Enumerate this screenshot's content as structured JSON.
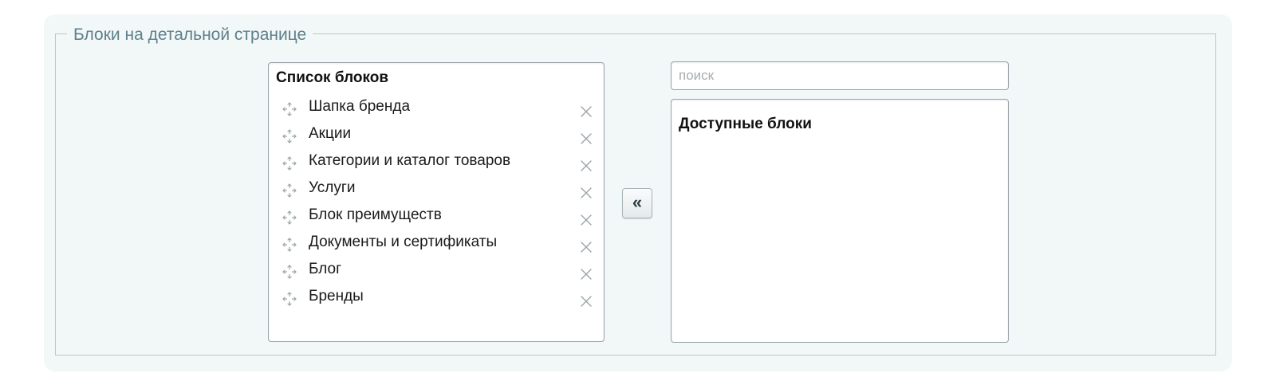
{
  "fieldset": {
    "legend": "Блоки на детальной странице"
  },
  "block_list": {
    "title": "Список блоков",
    "drag_icon": "drag-move-icon",
    "remove_icon": "close-x-icon",
    "items": [
      {
        "label": "Шапка бренда"
      },
      {
        "label": "Акции"
      },
      {
        "label": "Категории и каталог товаров"
      },
      {
        "label": "Услуги"
      },
      {
        "label": "Блок преимуществ"
      },
      {
        "label": "Документы и сертификаты"
      },
      {
        "label": "Блог"
      },
      {
        "label": "Бренды"
      }
    ]
  },
  "move_button": {
    "label": "«",
    "icon": "double-chevron-left-icon"
  },
  "search": {
    "placeholder": "поиск",
    "value": ""
  },
  "available": {
    "title": "Доступные блоки",
    "items": []
  },
  "colors": {
    "panel_background": "#f2f8f8",
    "legend_text": "#5e7f8c",
    "border": "#9aa4a8",
    "icon": "#9aa4a8"
  }
}
